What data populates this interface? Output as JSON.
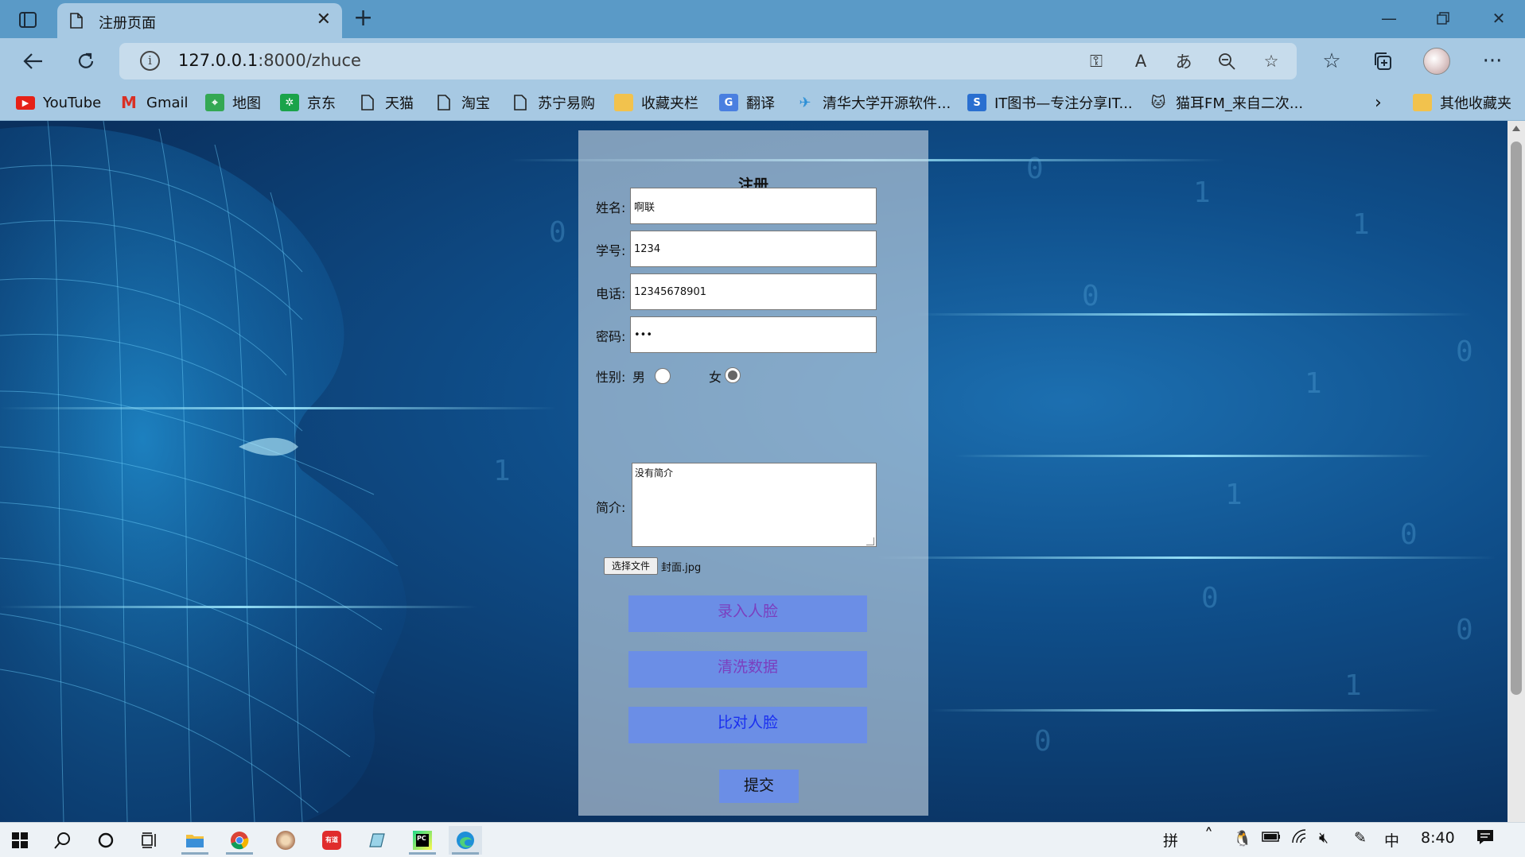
{
  "browser": {
    "tab_title": "注册页面",
    "url_host": "127.0.0.1",
    "url_rest": ":8000/zhuce",
    "bookmarks": [
      {
        "label": "YouTube",
        "icon": "youtube-icon",
        "color": "#e62117"
      },
      {
        "label": "Gmail",
        "icon": "gmail-icon",
        "color": "#d93025"
      },
      {
        "label": "地图",
        "icon": "maps-icon",
        "color": "#34a853"
      },
      {
        "label": "京东",
        "icon": "jd-icon",
        "color": "#1aa34a"
      },
      {
        "label": "天猫",
        "icon": "page-icon",
        "color": "#555555"
      },
      {
        "label": "淘宝",
        "icon": "page-icon",
        "color": "#555555"
      },
      {
        "label": "苏宁易购",
        "icon": "page-icon",
        "color": "#555555"
      },
      {
        "label": "收藏夹栏",
        "icon": "folder-icon",
        "color": "#f2c24d"
      },
      {
        "label": "翻译",
        "icon": "translate-icon",
        "color": "#4a7fe0"
      },
      {
        "label": "清华大学开源软件...",
        "icon": "tuna-icon",
        "color": "#2c8fd6"
      },
      {
        "label": "IT图书—专注分享IT...",
        "icon": "itbook-icon",
        "color": "#2a6fd0"
      },
      {
        "label": "猫耳FM_来自二次...",
        "icon": "missevan-icon",
        "color": "#222222"
      }
    ],
    "other_bookmarks": "其他收藏夹"
  },
  "form": {
    "title": "注册",
    "name_label": "姓名:",
    "name_value": "啊联",
    "id_label": "学号:",
    "id_value": "1234",
    "phone_label": "电话:",
    "phone_value": "12345678901",
    "password_label": "密码:",
    "password_value": "•••",
    "gender_label": "性别:",
    "gender_male": "男",
    "gender_female": "女",
    "gender_selected": "女",
    "intro_label": "简介:",
    "intro_value": "没有简介",
    "file_button": "选择文件",
    "file_name": "封面.jpg",
    "btn_enroll_face": "录入人脸",
    "btn_clean_data": "清洗数据",
    "btn_compare_face": "比对人脸",
    "btn_submit": "提交"
  },
  "taskbar": {
    "ime_mode": "拼",
    "lang": "中",
    "time": "8:40"
  },
  "colors": {
    "tabbar": "#5a9ac7",
    "toolbar": "#a7c9e3",
    "action_button": "#6b8ee6",
    "visited_link_text": "#7b3fbf",
    "link_text": "#1a2ff0"
  }
}
